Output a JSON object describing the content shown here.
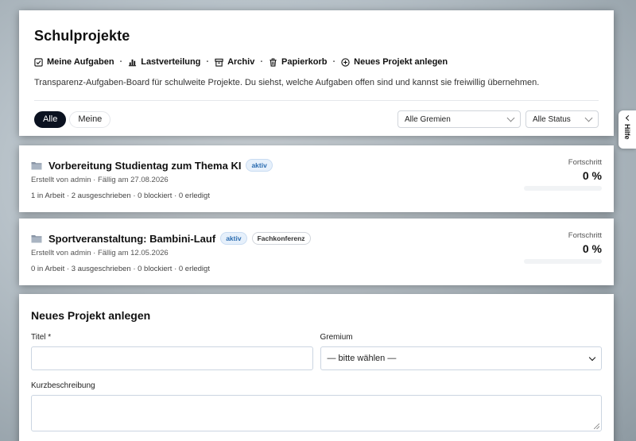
{
  "page": {
    "title": "Schulprojekte",
    "description": "Transparenz-Aufgaben-Board für schulweite Projekte. Du siehst, welche Aufgaben offen sind und kannst sie freiwillig übernehmen."
  },
  "nav": {
    "items": [
      {
        "label": "Meine Aufgaben",
        "icon": "checkbox-icon"
      },
      {
        "label": "Lastverteilung",
        "icon": "bar-chart-icon"
      },
      {
        "label": "Archiv",
        "icon": "archive-icon"
      },
      {
        "label": "Papierkorb",
        "icon": "trash-icon"
      },
      {
        "label": "Neues Projekt anlegen",
        "icon": "plus-circle-icon"
      }
    ],
    "separator": "·"
  },
  "filters": {
    "pills": [
      "Alle",
      "Meine"
    ],
    "active_pill": "Alle",
    "gremium_select": "Alle Gremien",
    "status_select": "Alle Status"
  },
  "projects": [
    {
      "title": "Vorbereitung Studientag zum Thema KI",
      "status": "aktiv",
      "gremium": "",
      "meta": "Erstellt von admin · Fällig am 27.08.2026",
      "counts": "1 in Arbeit · 2 ausgeschrieben · 0 blockiert · 0 erledigt",
      "progress_label": "Fortschritt",
      "progress_text": "0 %",
      "progress": 0
    },
    {
      "title": "Sportveranstaltung: Bambini-Lauf",
      "status": "aktiv",
      "gremium": "Fachkonferenz",
      "meta": "Erstellt von admin · Fällig am 12.05.2026",
      "counts": "0 in Arbeit · 3 ausgeschrieben · 0 blockiert · 0 erledigt",
      "progress_label": "Fortschritt",
      "progress_text": "0 %",
      "progress": 0
    }
  ],
  "form": {
    "title": "Neues Projekt anlegen",
    "title_label": "Titel *",
    "title_value": "",
    "gremium_label": "Gremium",
    "gremium_value": "— bitte wählen —",
    "description_label": "Kurzbeschreibung"
  },
  "help": {
    "label": "Hilfe"
  },
  "colors": {
    "accent": "#0b1220",
    "status_badge": "#2b6cb0"
  }
}
